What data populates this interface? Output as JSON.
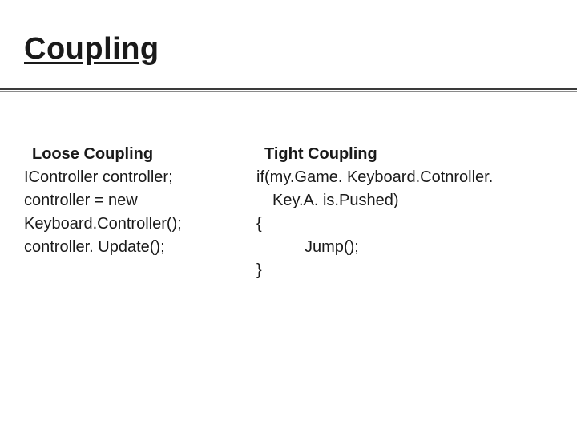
{
  "title": "Coupling",
  "left": {
    "heading": "Loose Coupling",
    "line1": "IController controller;",
    "line2": "controller = new Keyboard.Controller();",
    "line3": "controller. Update();"
  },
  "right": {
    "heading": "Tight Coupling",
    "line1": "if(my.Game. Keyboard.Cotnroller.",
    "line2": "Key.A. is.Pushed)",
    "line3": "{",
    "line4": "Jump();",
    "line5": "}"
  }
}
